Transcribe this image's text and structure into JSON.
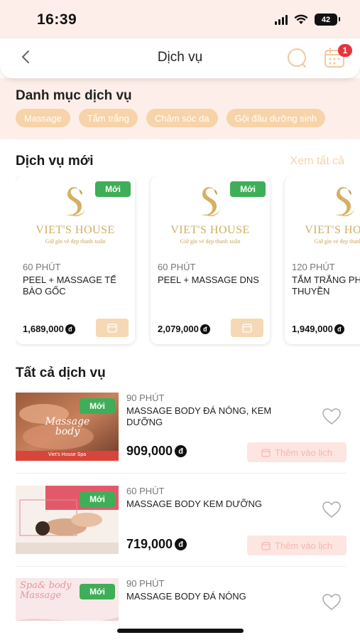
{
  "status_bar": {
    "time": "16:39",
    "battery": "42"
  },
  "header": {
    "title": "Dịch vụ",
    "notification_count": "1"
  },
  "categories": {
    "title": "Danh mục dịch vụ",
    "items": [
      "Massage",
      "Tắm trắng",
      "Chăm sóc da",
      "Gội đầu dưỡng sinh"
    ]
  },
  "new_services": {
    "title": "Dịch vụ mới",
    "see_all": "Xem tất cả",
    "badge": "Mới",
    "logo": {
      "name": "VIET'S HOUSE",
      "tagline": "Giữ gìn vẻ đẹp thanh xuân"
    },
    "cards": [
      {
        "duration": "60 PHÚT",
        "name": "PEEL + MASSAGE TẾ BÀO GỐC",
        "price": "1,689,000"
      },
      {
        "duration": "60 PHÚT",
        "name": "PEEL + MASSAGE DNS",
        "price": "2,079,000"
      },
      {
        "duration": "120 PHÚT",
        "name": "TẮM TRẮNG PHI THUYỀN",
        "price": "1,949,000"
      }
    ]
  },
  "all_services": {
    "title": "Tất cả dịch vụ",
    "badge": "Mới",
    "add_label": "Thêm vào lịch",
    "items": [
      {
        "duration": "90 PHÚT",
        "name": "MASSAGE BODY ĐÁ NÓNG, KEM DƯỠNG",
        "price": "909,000",
        "thumb_text": "Massage body",
        "thumb_footer": "Viet's House Spa"
      },
      {
        "duration": "60 PHÚT",
        "name": "MASSAGE BODY KEM DƯỠNG",
        "price": "719,000",
        "thumb_text": ""
      },
      {
        "duration": "90 PHÚT",
        "name": "MASSAGE BODY ĐÁ NÓNG",
        "price": "",
        "thumb_text": "Spa& body Massage"
      }
    ]
  },
  "currency_symbol": "đ",
  "colors": {
    "accent": "#f6d3a8",
    "badge_green": "#3fae58",
    "pink_bg": "#fdeee9",
    "gold": "#d1ae62"
  },
  "icons": [
    "back-icon",
    "search-icon",
    "calendar-icon",
    "cart-icon",
    "heart-icon",
    "calendar-add-icon",
    "swan-logo-icon"
  ]
}
